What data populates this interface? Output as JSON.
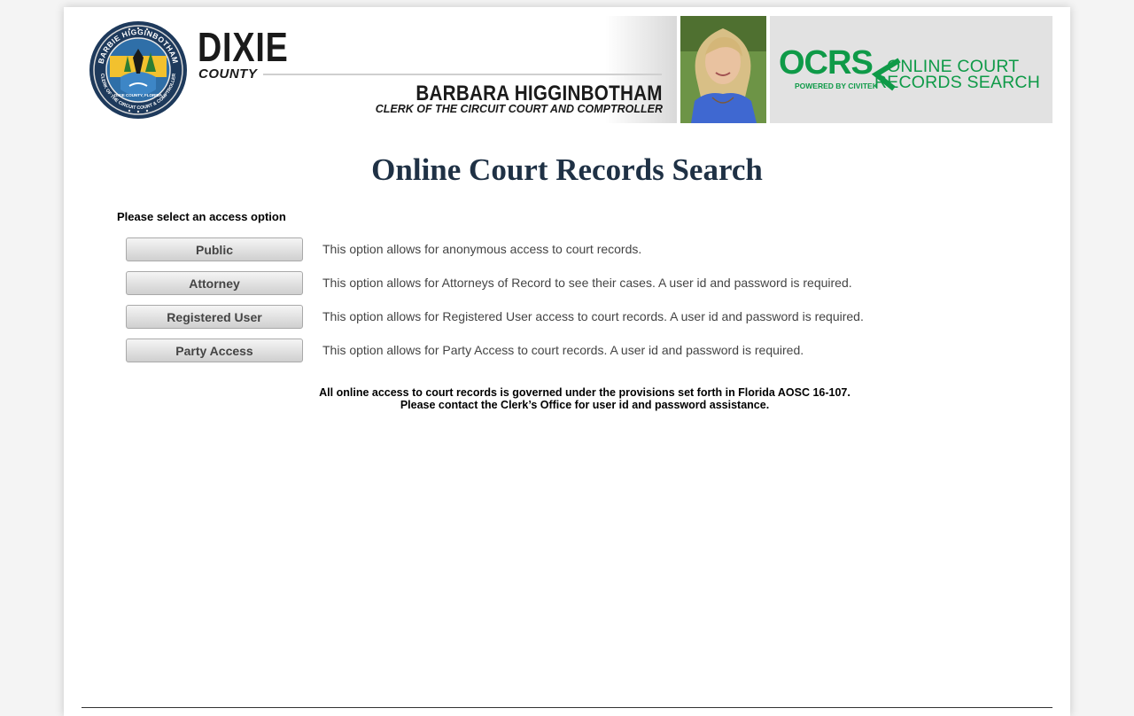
{
  "banner": {
    "seal_text_top": "BARBIE HIGGINBOTHAM",
    "seal_text_bottom": "CLERK OF THE CIRCUIT COURT & COMPTROLLER",
    "seal_text_center": "DIXIE COUNTY, FLORIDA",
    "county_name": "DIXIE",
    "county_word": "COUNTY",
    "clerk_name": "BARBARA HIGGINBOTHAM",
    "clerk_title": "CLERK OF THE CIRCUIT COURT AND COMPTROLLER",
    "ocrs_mark": "OCRS",
    "ocrs_powered": "POWERED BY CIVITEK",
    "ocrs_line1": "ONLINE COURT",
    "ocrs_line2": "RECORDS SEARCH"
  },
  "main": {
    "title": "Online Court Records Search",
    "select_label": "Please select an access option",
    "options": [
      {
        "label": "Public",
        "description": "This option allows for anonymous access to court records."
      },
      {
        "label": "Attorney",
        "description": "This option allows for Attorneys of Record to see their cases. A user id and password is required."
      },
      {
        "label": "Registered User",
        "description": "This option allows for Registered User access to court records. A user id and password is required."
      },
      {
        "label": "Party Access",
        "description": "This option allows for Party Access to court records. A user id and password is required."
      }
    ],
    "notice_line1": "All online access to court records is governed under the provisions set forth in Florida AOSC 16-107.",
    "notice_line2": "Please contact the Clerk’s Office for user id and password assistance."
  },
  "colors": {
    "title": "#1f3145",
    "ocrs_green": "#0f9a48",
    "description_text": "#444444"
  }
}
